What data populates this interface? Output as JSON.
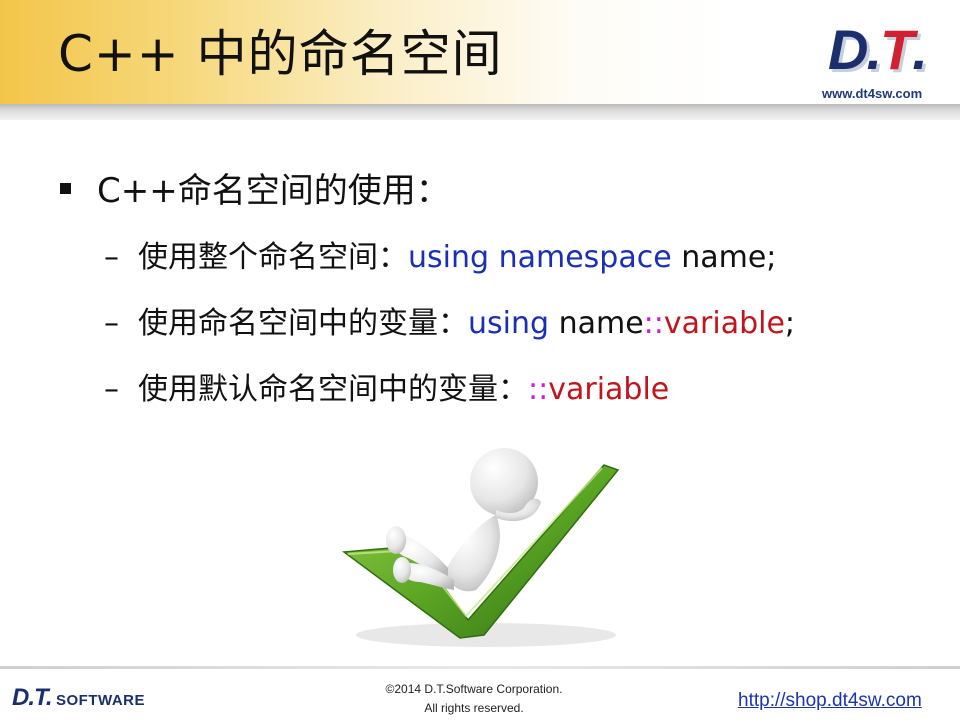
{
  "slide": {
    "title": "C++ 中的命名空间"
  },
  "logo": {
    "d": "D",
    "dot1": ".",
    "t": "T",
    "dot2": ".",
    "url": "www.dt4sw.com"
  },
  "bullet": {
    "text": "C++命名空间的使用："
  },
  "subitems": [
    {
      "dash": "–",
      "label": "使用整个命名空间：",
      "keyword": "using namespace",
      "rest": " name;"
    },
    {
      "dash": "–",
      "label": "使用命名空间中的变量：",
      "keyword": "using",
      "name": " name",
      "scope": "::",
      "variable": "variable",
      "tail": ";"
    },
    {
      "dash": "–",
      "label": "使用默认命名空间中的变量：",
      "scope": "::",
      "variable": "variable"
    }
  ],
  "footer": {
    "logo_dt": "D.T.",
    "logo_software": "SOFTWARE",
    "copyright_line1": "©2014 D.T.Software Corporation.",
    "copyright_line2": "All rights reserved.",
    "link": "http://shop.dt4sw.com"
  },
  "colors": {
    "keyword": "#1a2fb5",
    "variable": "#c0151f",
    "scope": "#d11bd0",
    "checkmark": "#5da825"
  }
}
